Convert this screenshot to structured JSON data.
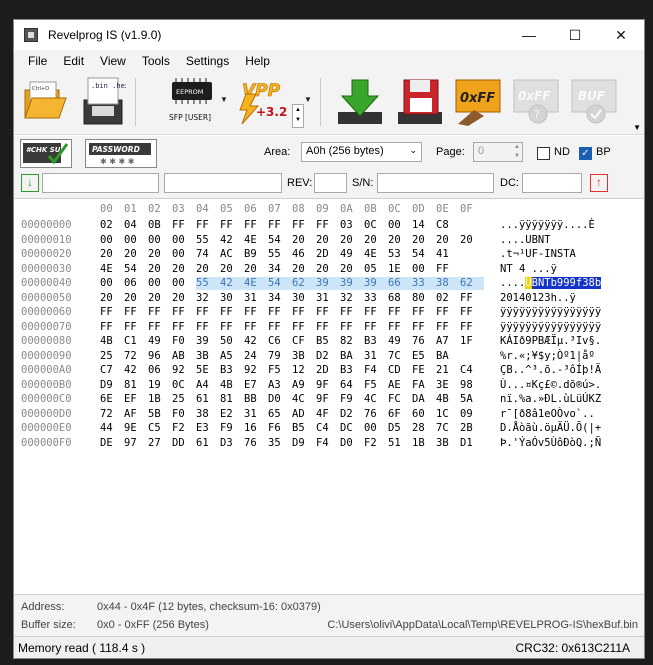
{
  "window": {
    "title": "Revelprog IS (v1.9.0)"
  },
  "menu": [
    "File",
    "Edit",
    "View",
    "Tools",
    "Settings",
    "Help"
  ],
  "toolbar": {
    "open_icon_text": "Ctrl+O",
    "binhex_icon_text": ".bin .hex",
    "chip_label": "EEPROM",
    "chip_type": "SFP [USER]",
    "vpp_label": "VPP",
    "vpp_value": "+3.2",
    "fill_ff_label": "0xFF",
    "fill_ff_disabled_label": "0xFF",
    "buf_label": "BUF"
  },
  "options": {
    "chksum_label": "#CHK SUM",
    "password_label": "PASSWORD",
    "area_label": "Area:",
    "area_value": "A0h (256 bytes)",
    "page_label": "Page:",
    "page_value": "0",
    "nd_label": "ND",
    "bp_label": "BP"
  },
  "row3": {
    "rev_label": "REV:",
    "sn_label": "S/N:",
    "dc_label": "DC:"
  },
  "hex": {
    "columns": [
      "00",
      "01",
      "02",
      "03",
      "04",
      "05",
      "06",
      "07",
      "08",
      "09",
      "0A",
      "0B",
      "0C",
      "0D",
      "0E",
      "0F"
    ],
    "rows": [
      {
        "addr": "00000000",
        "bytes": [
          "02",
          "04",
          "0B",
          "FF",
          "FF",
          "FF",
          "FF",
          "FF",
          "FF",
          "FF",
          "03",
          "0C",
          "00",
          "14",
          "C8",
          ""
        ],
        "ascii": "...ÿÿÿÿÿÿÿ....È"
      },
      {
        "addr": "00000010",
        "bytes": [
          "00",
          "00",
          "00",
          "00",
          "55",
          "42",
          "4E",
          "54",
          "20",
          "20",
          "20",
          "20",
          "20",
          "20",
          "20",
          "20"
        ],
        "ascii": "....UBNT"
      },
      {
        "addr": "00000020",
        "bytes": [
          "20",
          "20",
          "20",
          "00",
          "74",
          "AC",
          "B9",
          "55",
          "46",
          "2D",
          "49",
          "4E",
          "53",
          "54",
          "41",
          ""
        ],
        "ascii": ".t¬¹UF-INSTA"
      },
      {
        "addr": "00000030",
        "bytes": [
          "4E",
          "54",
          "20",
          "20",
          "20",
          "20",
          "20",
          "34",
          "20",
          "20",
          "20",
          "05",
          "1E",
          "00",
          "FF",
          ""
        ],
        "ascii": "NT        4    ...ÿ"
      },
      {
        "addr": "00000040",
        "bytes": [
          "00",
          "06",
          "00",
          "00",
          "55",
          "42",
          "4E",
          "54",
          "62",
          "39",
          "39",
          "39",
          "66",
          "33",
          "38",
          "62"
        ],
        "ascii": "....UBNTb999f38b"
      },
      {
        "addr": "00000050",
        "bytes": [
          "20",
          "20",
          "20",
          "20",
          "32",
          "30",
          "31",
          "34",
          "30",
          "31",
          "32",
          "33",
          "68",
          "80",
          "02",
          "FF"
        ],
        "ascii": "    20140123h..ÿ"
      },
      {
        "addr": "00000060",
        "bytes": [
          "FF",
          "FF",
          "FF",
          "FF",
          "FF",
          "FF",
          "FF",
          "FF",
          "FF",
          "FF",
          "FF",
          "FF",
          "FF",
          "FF",
          "FF",
          "FF"
        ],
        "ascii": "ÿÿÿÿÿÿÿÿÿÿÿÿÿÿÿÿ"
      },
      {
        "addr": "00000070",
        "bytes": [
          "FF",
          "FF",
          "FF",
          "FF",
          "FF",
          "FF",
          "FF",
          "FF",
          "FF",
          "FF",
          "FF",
          "FF",
          "FF",
          "FF",
          "FF",
          "FF"
        ],
        "ascii": "ÿÿÿÿÿÿÿÿÿÿÿÿÿÿÿÿ"
      },
      {
        "addr": "00000080",
        "bytes": [
          "4B",
          "C1",
          "49",
          "F0",
          "39",
          "50",
          "42",
          "C6",
          "CF",
          "B5",
          "82",
          "B3",
          "49",
          "76",
          "A7",
          "1F"
        ],
        "ascii": "KÁIð9PBÆÏµ.³Iv§."
      },
      {
        "addr": "00000090",
        "bytes": [
          "25",
          "72",
          "96",
          "AB",
          "3B",
          "A5",
          "24",
          "79",
          "3B",
          "D2",
          "BA",
          "31",
          "7C",
          "E5",
          "BA",
          ""
        ],
        "ascii": "%r.«;¥$y;Òº1|åº"
      },
      {
        "addr": "000000A0",
        "bytes": [
          "C7",
          "42",
          "06",
          "92",
          "5E",
          "B3",
          "92",
          "F5",
          "12",
          "2D",
          "B3",
          "F4",
          "CD",
          "FE",
          "21",
          "C4"
        ],
        "ascii": "ÇB..^³.õ.-³ôÍþ!Ä"
      },
      {
        "addr": "000000B0",
        "bytes": [
          "D9",
          "81",
          "19",
          "0C",
          "A4",
          "4B",
          "E7",
          "A3",
          "A9",
          "9F",
          "64",
          "F5",
          "AE",
          "FA",
          "3E",
          "98"
        ],
        "ascii": "Ù...¤Kç£©.dõ®ú>."
      },
      {
        "addr": "000000C0",
        "bytes": [
          "6E",
          "EF",
          "1B",
          "25",
          "61",
          "81",
          "BB",
          "D0",
          "4C",
          "9F",
          "F9",
          "4C",
          "FC",
          "DA",
          "4B",
          "5A"
        ],
        "ascii": "nï.%a.»ÐL.ùLüÚKZ"
      },
      {
        "addr": "000000D0",
        "bytes": [
          "72",
          "AF",
          "5B",
          "F0",
          "38",
          "E2",
          "31",
          "65",
          "AD",
          "4F",
          "D2",
          "76",
          "6F",
          "60",
          "1C",
          "09"
        ],
        "ascii": "r¯[ð8â1e­OÒvo`.."
      },
      {
        "addr": "000000E0",
        "bytes": [
          "44",
          "9E",
          "C5",
          "F2",
          "E3",
          "F9",
          "16",
          "F6",
          "B5",
          "C4",
          "DC",
          "00",
          "D5",
          "28",
          "7C",
          "2B"
        ],
        "ascii": "D.Åòãù.öµÄÜ.Õ(|+"
      },
      {
        "addr": "000000F0",
        "bytes": [
          "DE",
          "97",
          "27",
          "DD",
          "61",
          "D3",
          "76",
          "35",
          "D9",
          "F4",
          "D0",
          "F2",
          "51",
          "1B",
          "3B",
          "D1"
        ],
        "ascii": "Þ.'ÝaÓv5ÙôÐòQ.;Ñ"
      }
    ]
  },
  "status": {
    "address_label": "Address:",
    "address_value": "0x44 - 0x4F (12 bytes, checksum-16: 0x0379)",
    "buffer_label": "Buffer size:",
    "buffer_value": "0x0 - 0xFF (256 Bytes)",
    "buffer_path": "C:\\Users\\olivi\\AppData\\Local\\Temp\\REVELPROG-IS\\hexBuf.bin",
    "memory_read": "Memory read ( 118.4 s )",
    "crc": "CRC32: 0x613C211A"
  }
}
